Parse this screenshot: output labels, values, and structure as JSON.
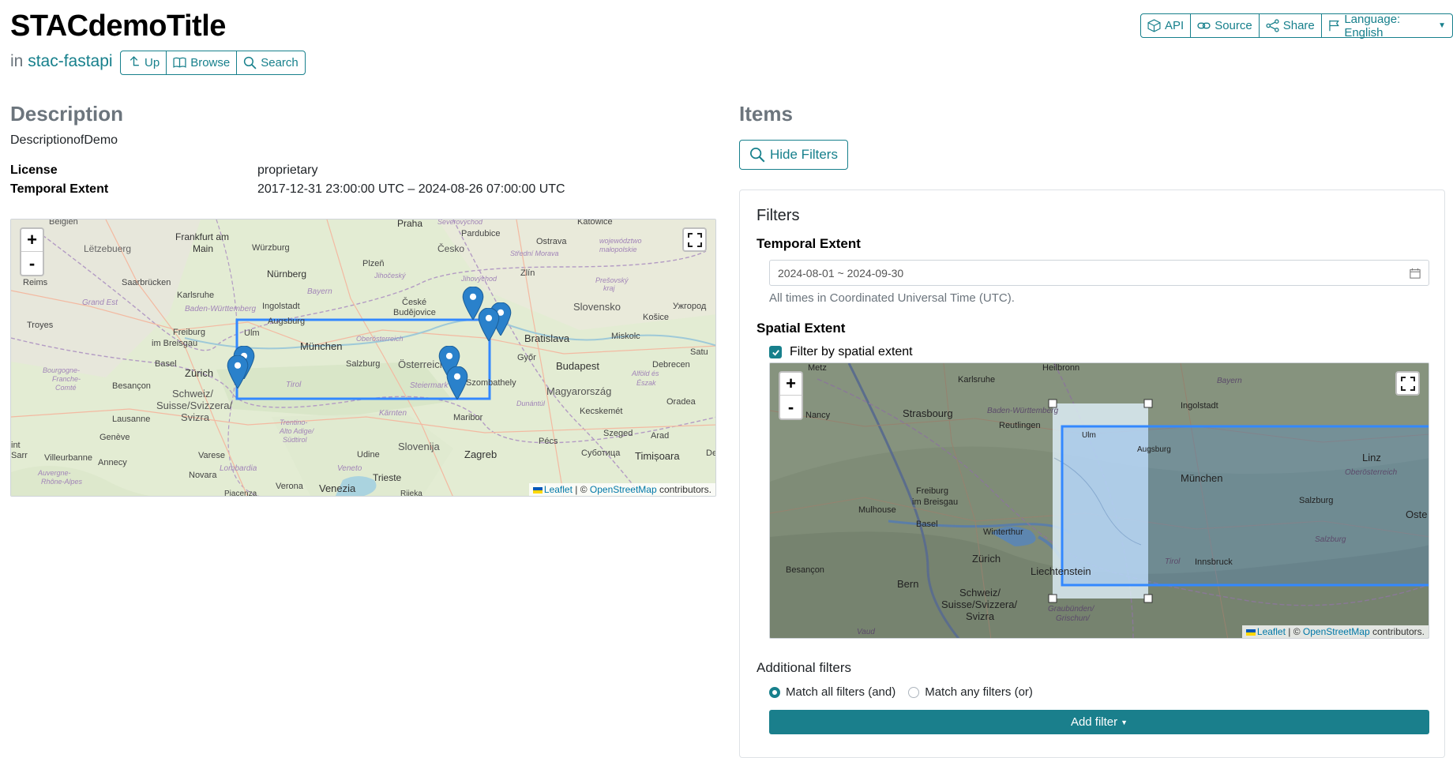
{
  "header": {
    "title": "STACdemoTitle",
    "in_prefix": "in",
    "parent_link": "stac-fastapi",
    "nav": {
      "up": "Up",
      "browse": "Browse",
      "search": "Search"
    },
    "top": {
      "api": "API",
      "source": "Source",
      "share": "Share",
      "language": "Language: English"
    }
  },
  "description": {
    "heading": "Description",
    "text": "DescriptionofDemo",
    "license_label": "License",
    "license_value": "proprietary",
    "temporal_label": "Temporal Extent",
    "temporal_value": "2017-12-31 23:00:00 UTC – 2024-08-26 07:00:00 UTC"
  },
  "overview_map": {
    "labels": {
      "belgien": "Belgien",
      "frankfurt": "Frankfurt am",
      "main": "Main",
      "wurzburg": "Würzburg",
      "letzeburg": "Lëtzebuerg",
      "praha": "Praha",
      "pardubice": "Pardubice",
      "katowice": "Katowice",
      "cesko": "Česko",
      "ostrava": "Ostrava",
      "nurnberg": "Nürnberg",
      "plzen": "Plzeň",
      "zlin": "Zlín",
      "saarbrucken": "Saarbrücken",
      "karlsruhe": "Karlsruhe",
      "reims": "Reims",
      "bayern": "Bayern",
      "jihocesky": "Jihočeský",
      "ceske": "České",
      "budejovice": "Budějovice",
      "ingolstadt": "Ingolstadt",
      "augsburg": "Augsburg",
      "slovensko": "Slovensko",
      "uzhorod": "Ужгород",
      "kosice": "Košice",
      "troyes": "Troyes",
      "ulm": "Ulm",
      "freiburg": "Freiburg",
      "im_breisgau": "im Breisgau",
      "munchen": "München",
      "oberosterreich": "Oberösterreich",
      "bratislava": "Bratislava",
      "miskolc": "Miskolc",
      "basel": "Basel",
      "zurich": "Zürich",
      "salzburg": "Salzburg",
      "osterreich": "Österreich",
      "gyor": "Győr",
      "budapest": "Budapest",
      "debrecen": "Debrecen",
      "satu": "Satu",
      "besancon": "Besançon",
      "schweiz": "Schweiz/",
      "suisse": "Suisse/Svizzera/",
      "svizra": "Svizra",
      "tirol": "Tirol",
      "steiermark": "Steiermark",
      "szombathely": "Szombathely",
      "magyarorszag": "Magyarország",
      "oradea": "Oradea",
      "lausanne": "Lausanne",
      "karnten": "Kärnten",
      "maribor": "Maribor",
      "kecskemet": "Kecskemét",
      "geneve": "Genève",
      "trentino": "Trentino-",
      "alto_adige": "Alto Adige/",
      "sudtirol": "Südtirol",
      "szeged": "Szeged",
      "arad": "Arad",
      "annecy": "Annecy",
      "varese": "Varese",
      "udine": "Udine",
      "slovenija": "Slovenija",
      "zagreb": "Zagreb",
      "pecs": "Pécs",
      "subotica": "Суботица",
      "timisoara": "Timișoara",
      "villeurbanne": "Villeurbanne",
      "lombardia": "Lombardia",
      "veneto": "Veneto",
      "trieste": "Trieste",
      "novara": "Novara",
      "verona": "Verona",
      "venezia": "Venezia",
      "rijeka": "Rijeka",
      "piacenza": "Piacenza",
      "auvergne": "Auvergne-",
      "rhone_alpes": "Rhône-Alpes",
      "bourgogne": "Bourgogne-",
      "franche": "Franche-",
      "comte": "Comté",
      "grand_est": "Grand Est",
      "baden": "Baden-Württemberg",
      "severovychod": "Severovýchod",
      "stredni_morava": "Střední Morava",
      "wojewodztwo": "województwo",
      "malopolskie": "małopolskie",
      "presovsky": "Prešovský",
      "kraj": "kraj",
      "jihovychod": "Jihovýchod",
      "dunantul": "Dunántúl",
      "alfold": "Alföld és",
      "eszak": "Észak",
      "int": "int",
      "des": "Des",
      "sarr": "Sarr"
    },
    "attribution": {
      "leaflet": "Leaflet",
      "sep": " | © ",
      "osm": "OpenStreetMap",
      "contrib": " contributors."
    }
  },
  "items": {
    "heading": "Items",
    "hide_filters": "Hide Filters",
    "filters_title": "Filters",
    "temporal_label": "Temporal Extent",
    "date_range": "2024-08-01 ~ 2024-09-30",
    "utc_hint": "All times in Coordinated Universal Time (UTC).",
    "spatial_label": "Spatial Extent",
    "spatial_checkbox": "Filter by spatial extent",
    "additional_filters": "Additional filters",
    "match_all": "Match all filters (and)",
    "match_any": "Match any filters (or)",
    "add_filter": "Add filter"
  },
  "spatial_map": {
    "labels": {
      "metz": "Metz",
      "karlsruhe": "Karlsruhe",
      "heilbronn": "Heilbronn",
      "bayern": "Bayern",
      "nancy": "Nancy",
      "strasbourg": "Strasbourg",
      "baden": "Baden-Württemberg",
      "reutlingen": "Reutlingen",
      "ingolstadt": "Ingolstadt",
      "ulm": "Ulm",
      "augsburg": "Augsburg",
      "linz": "Linz",
      "munchen": "München",
      "oberosterreich": "Oberösterreich",
      "freiburg": "Freiburg",
      "im_breisgau": "im Breisgau",
      "mulhouse": "Mulhouse",
      "basel": "Basel",
      "winterthur": "Winterthur",
      "salzburg": "Salzburg",
      "oste": "Oste",
      "zurich": "Zürich",
      "tirol": "Tirol",
      "innsbruck": "Innsbruck",
      "salzburg_r": "Salzburg",
      "besancon": "Besançon",
      "liechtenstein": "Liechtenstein",
      "bern": "Bern",
      "schweiz": "Schweiz/",
      "suisse": "Suisse/Svizzera/",
      "svizra": "Svizra",
      "graubunden": "Graubünden/",
      "grischun": "Grischun/",
      "vaud": "Vaud"
    },
    "attribution": {
      "leaflet": "Leaflet",
      "sep": " | © ",
      "osm": "OpenStreetMap",
      "contrib": " contributors."
    }
  },
  "colors": {
    "accent": "#17808c",
    "bbox": "#3388ff",
    "marker": "#2a81cb"
  }
}
